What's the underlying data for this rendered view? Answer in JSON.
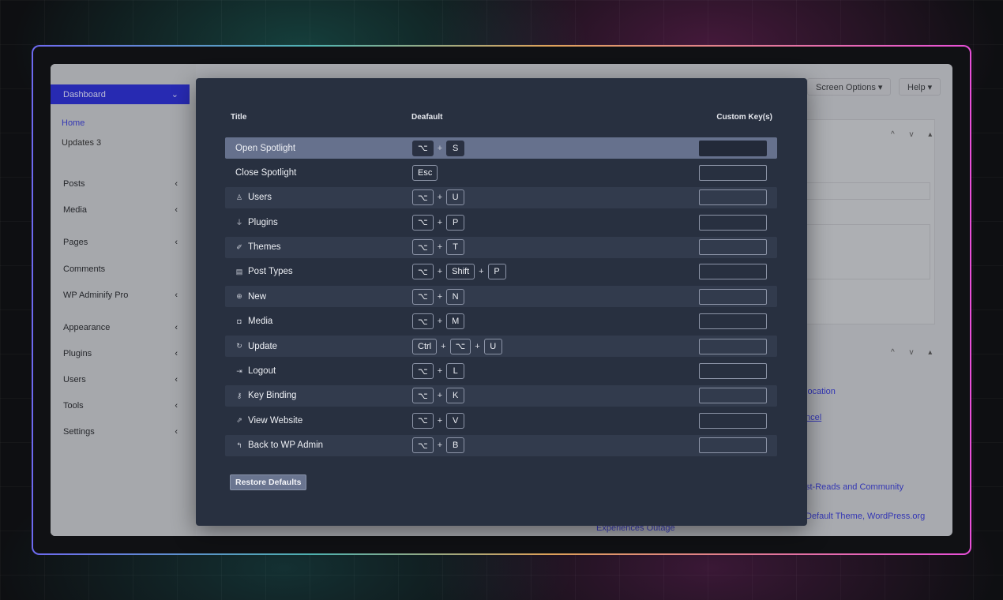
{
  "wp": {
    "dashboard": "Dashboard",
    "home": "Home",
    "updates": "Updates 3",
    "menu": [
      {
        "label": "Posts",
        "arrow": "‹"
      },
      {
        "label": "Media",
        "arrow": "‹"
      },
      {
        "label": "Pages",
        "arrow": "‹"
      },
      {
        "label": "Comments",
        "arrow": ""
      },
      {
        "label": "WP Adminify Pro",
        "arrow": "‹"
      },
      {
        "label": "Appearance",
        "arrow": "‹"
      },
      {
        "label": "Plugins",
        "arrow": "‹"
      },
      {
        "label": "Users",
        "arrow": "‹"
      },
      {
        "label": "Tools",
        "arrow": "‹"
      },
      {
        "label": "Settings",
        "arrow": "‹"
      }
    ],
    "screen_options": "Screen Options ▾",
    "help": "Help ▾",
    "links": {
      "location": "location",
      "cancel": "ncel",
      "reads": "st-Reads and Community",
      "theme": "Default Theme, WordPress.org",
      "outage": "Experiences Outage"
    }
  },
  "modal": {
    "headers": {
      "title": "Title",
      "default": "Deafault",
      "custom": "Custom Key(s)"
    },
    "restore_label": "Restore Defaults",
    "rows": [
      {
        "title": "Open Spotlight",
        "icon": "",
        "keys": [
          "⌥",
          "S"
        ]
      },
      {
        "title": "Close Spotlight",
        "icon": "",
        "keys": [
          "Esc"
        ]
      },
      {
        "title": "Users",
        "icon": "user-icon",
        "keys": [
          "⌥",
          "U"
        ]
      },
      {
        "title": "Plugins",
        "icon": "plug-icon",
        "keys": [
          "⌥",
          "P"
        ]
      },
      {
        "title": "Themes",
        "icon": "brush-icon",
        "keys": [
          "⌥",
          "T"
        ]
      },
      {
        "title": "Post Types",
        "icon": "document-icon",
        "keys": [
          "⌥",
          "Shift",
          "P"
        ]
      },
      {
        "title": "New",
        "icon": "plus-circle-icon",
        "keys": [
          "⌥",
          "N"
        ]
      },
      {
        "title": "Media",
        "icon": "camera-icon",
        "keys": [
          "⌥",
          "M"
        ]
      },
      {
        "title": "Update",
        "icon": "refresh-icon",
        "keys": [
          "Ctrl",
          "⌥",
          "U"
        ]
      },
      {
        "title": "Logout",
        "icon": "logout-icon",
        "keys": [
          "⌥",
          "L"
        ]
      },
      {
        "title": "Key Binding",
        "icon": "key-icon",
        "keys": [
          "⌥",
          "K"
        ]
      },
      {
        "title": "View Website",
        "icon": "external-link-icon",
        "keys": [
          "⌥",
          "V"
        ]
      },
      {
        "title": "Back to WP Admin",
        "icon": "back-arrow-icon",
        "keys": [
          "⌥",
          "B"
        ]
      }
    ]
  }
}
